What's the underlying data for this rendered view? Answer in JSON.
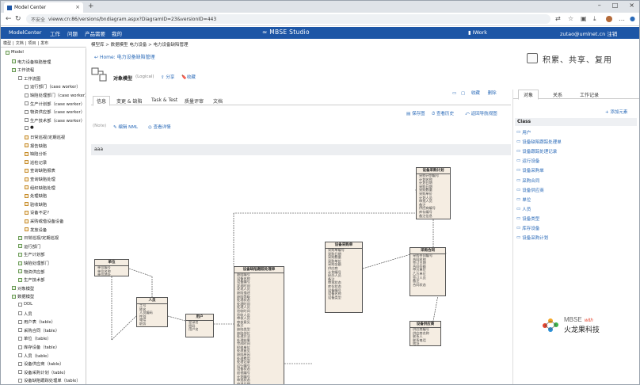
{
  "browser": {
    "tab_title": "Model Center",
    "address_prefix": "不安全",
    "url": "vieww.cn:86/versions/bndiagram.aspx?DiagramID=23&versionID=443"
  },
  "appbar": {
    "items": [
      "ModelCenter",
      "工作",
      "问题",
      "产品需要",
      "我的"
    ],
    "brand": "MBSE Studio",
    "iwork": "IWork",
    "user": "zutao@umlnet.cn 注销"
  },
  "lbar": [
    "模型",
    "文档",
    "项目",
    "发布"
  ],
  "tree": [
    {
      "label": "Model",
      "d": 0,
      "t": "g"
    },
    {
      "label": "电力设备缺陷管理",
      "d": 1,
      "t": "g"
    },
    {
      "label": "工作流程",
      "d": 1,
      "t": "g"
    },
    {
      "label": "工作流图",
      "d": 2,
      "t": ""
    },
    {
      "label": "运行部门（case worker）",
      "d": 3,
      "t": ""
    },
    {
      "label": "缺陷处理部门（case worker）",
      "d": 3,
      "t": ""
    },
    {
      "label": "生产计划部（case worker）",
      "d": 3,
      "t": ""
    },
    {
      "label": "物资供应部（case worker）",
      "d": 3,
      "t": ""
    },
    {
      "label": "生产技术部（case worker）",
      "d": 3,
      "t": ""
    },
    {
      "label": "●",
      "d": 3,
      "t": ""
    },
    {
      "label": "日常巡视/定期巡视",
      "d": 3,
      "t": "o"
    },
    {
      "label": "报告缺陷",
      "d": 3,
      "t": "o"
    },
    {
      "label": "缺陷分析",
      "d": 3,
      "t": "o"
    },
    {
      "label": "巡检记录",
      "d": 3,
      "t": "o"
    },
    {
      "label": "查询缺陷报表",
      "d": 3,
      "t": "o"
    },
    {
      "label": "查询缺陷处理",
      "d": 3,
      "t": "o"
    },
    {
      "label": "组织缺陷处理",
      "d": 3,
      "t": "o"
    },
    {
      "label": "处理缺陷",
      "d": 3,
      "t": "o"
    },
    {
      "label": "验收缺陷",
      "d": 3,
      "t": "o"
    },
    {
      "label": "设备不足?",
      "d": 3,
      "t": "o"
    },
    {
      "label": "采购或借设备设备",
      "d": 3,
      "t": "o"
    },
    {
      "label": "发放设备",
      "d": 3,
      "t": "o"
    },
    {
      "label": "日常巡视/定期巡视",
      "d": 2,
      "t": "g"
    },
    {
      "label": "运行部门",
      "d": 2,
      "t": "g"
    },
    {
      "label": "生产计划部",
      "d": 2,
      "t": "g"
    },
    {
      "label": "缺陷处理部门",
      "d": 2,
      "t": "g"
    },
    {
      "label": "物资供应部",
      "d": 2,
      "t": "g"
    },
    {
      "label": "生产技术部",
      "d": 2,
      "t": "g"
    },
    {
      "label": "对象模型",
      "d": 1,
      "t": "g"
    },
    {
      "label": "数据模型",
      "d": 1,
      "t": "g"
    },
    {
      "label": "DDL",
      "d": 2,
      "t": ""
    },
    {
      "label": "人员",
      "d": 2,
      "t": ""
    },
    {
      "label": "用户表（table）",
      "d": 2,
      "t": ""
    },
    {
      "label": "采购合同（table）",
      "d": 2,
      "t": ""
    },
    {
      "label": "单位（table）",
      "d": 2,
      "t": ""
    },
    {
      "label": "库存设备（table）",
      "d": 2,
      "t": ""
    },
    {
      "label": "人员（table）",
      "d": 2,
      "t": ""
    },
    {
      "label": "设备供应商（table）",
      "d": 2,
      "t": ""
    },
    {
      "label": "设备采购计划（table）",
      "d": 2,
      "t": ""
    },
    {
      "label": "设备缺陷跟踪处理单（table）",
      "d": 2,
      "t": ""
    }
  ],
  "crumb": "模型库 > 数据模型 电力设备 > 电力设备缺陷管理",
  "home": "Home: 电力设备缺陷管理",
  "slogan": "积累、共享、复用",
  "obj": {
    "title": "对象模型",
    "type": "(Logical)",
    "share": "分享",
    "collect": "收藏"
  },
  "viewbtns": [
    "收藏",
    "删除"
  ],
  "tabs": [
    "信息",
    "变更 & 缺陷",
    "Task & Test",
    "质量评审",
    "文档"
  ],
  "toolrow": [
    "保存图",
    "查看历史",
    "返回导航视图"
  ],
  "subrow": {
    "note": "(Note)",
    "xml": "编辑 NML",
    "detail": "查看详情"
  },
  "section": "aaa",
  "rpanel": {
    "tabs": [
      "对象",
      "关系",
      "工作记录"
    ],
    "add": "+ 添加元素",
    "header": "Class",
    "items": [
      "用户",
      "设备缺陷跟踪处理单",
      "设备跟踪处理记录",
      "运行设备",
      "设备采购单",
      "采购合同",
      "设备供应商",
      "单位",
      "人员",
      "设备类型",
      "库存设备",
      "设备采购计划"
    ]
  },
  "diagram": {
    "classes": [
      {
        "name": "设备采购计划",
        "attrs": [
          "采购计划编号",
          "计划名称",
          "计划日期",
          "采购日期",
          "采购数量",
          "采购单价",
          "计划人员",
          "审批人员",
          "备注",
          "供应商编号",
          "库存编号",
          "备注信息"
        ]
      },
      {
        "name": "设备采购单",
        "attrs": [
          "采购单编号",
          "采购日期",
          "采购数量",
          "采购单价",
          "采购金额",
          "供应商",
          "计划编号",
          "经办人员",
          "备注",
          "审批状态",
          "库存状态",
          "设备编号",
          "设备名称",
          "设备类型"
        ]
      },
      {
        "name": "采购合同",
        "attrs": [
          "采购合同编号",
          "合同名称",
          "签订日期",
          "合同金额",
          "甲方单位",
          "乙方单位",
          "签订人员",
          "备注",
          "合同状态"
        ]
      },
      {
        "name": "设备供应商",
        "attrs": [
          "供应商编号",
          "供应商名称",
          "联系人",
          "联系电话",
          "地址",
          "备注"
        ]
      },
      {
        "name": "设备缺陷跟踪处理单",
        "attrs": [
          "缺陷编号",
          "设备名称",
          "设备编号",
          "发现时间",
          "发现人员",
          "缺陷描述",
          "缺陷等级",
          "处理状态",
          "处理时间",
          "处理人员",
          "验收时间",
          "验收人员",
          "审核人员",
          "审核意见",
          "备注",
          "缺陷类型",
          "缺陷部位",
          "处理方法",
          "处理结果",
          "完成时间",
          "检修单位",
          "处理意见",
          "缺陷原因",
          "处理费用",
          "处理记录",
          "运行编号",
          "设备状态",
          "巡视编号",
          "计划编号",
          "审批状态",
          "申请日期",
          "录入人员",
          "录入时间",
          "修改人员"
        ]
      },
      {
        "name": "单位",
        "attrs": [
          "单位编号",
          "单位名称",
          "单位地址"
        ]
      },
      {
        "name": "人员",
        "attrs": [
          "工号",
          "姓名",
          "人员编码",
          "性别",
          "电话",
          "职务"
        ]
      },
      {
        "name": "用户",
        "attrs": [
          "登录名",
          "密码",
          "用户名"
        ]
      }
    ]
  },
  "logo": {
    "line1": "MBSE",
    "line1b": "with",
    "line2": "火龙果科技"
  },
  "colors": {
    "appbar": "#1d56a6",
    "link": "#2a6ab8",
    "class_fill": "#f5ede2"
  }
}
